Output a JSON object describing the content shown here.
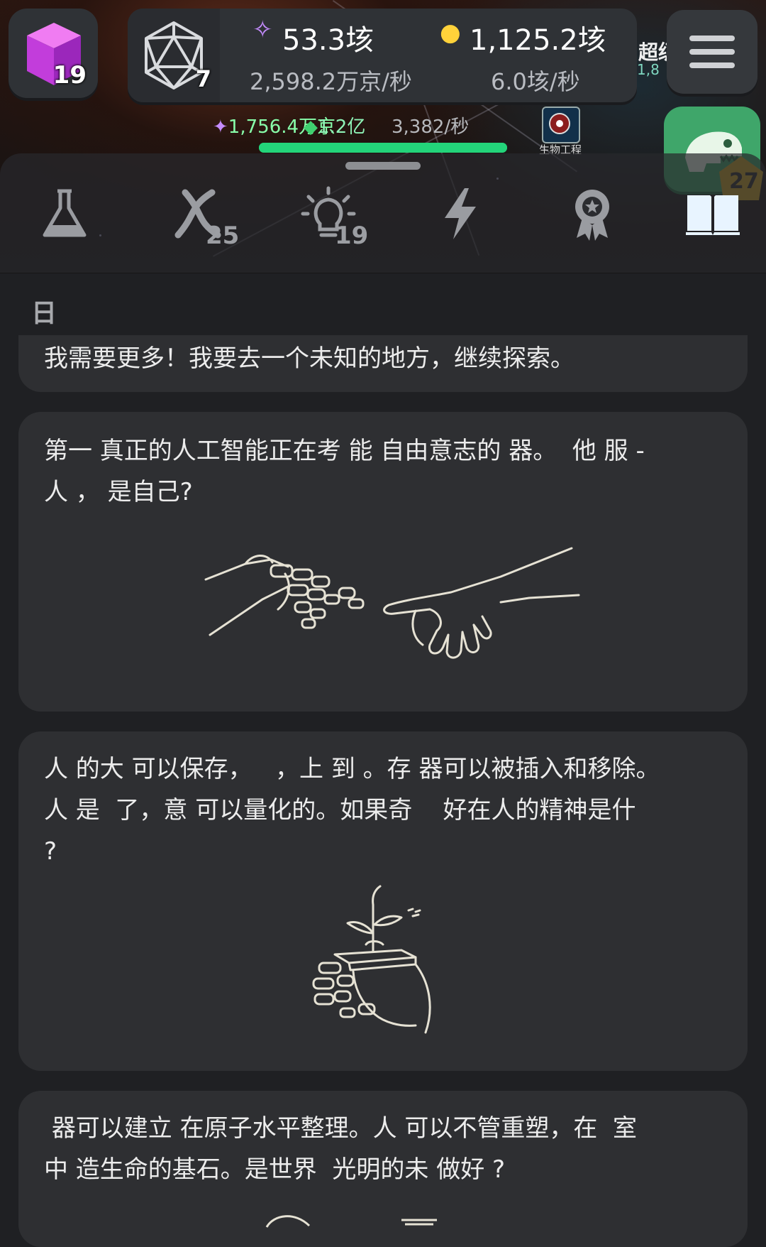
{
  "hud": {
    "cube_level": "19",
    "d20_level": "7",
    "resource1_value": "53.3垓",
    "resource1_rate": "2,598.2万京/秒",
    "resource2_value": "1,125.2垓",
    "resource2_rate": "6.0垓/秒",
    "side_label": "超级",
    "side_sub": "1,8",
    "dino_badge": "27"
  },
  "background": {
    "mid_left_value": "1,756.4万京",
    "gem_value": "1.2亿",
    "gem_rate": "3,382/秒",
    "bio_label": "生物工程",
    "progress": 1.0
  },
  "tabs": [
    {
      "name": "lab",
      "count": ""
    },
    {
      "name": "dna",
      "count": "25"
    },
    {
      "name": "idea",
      "count": "19"
    },
    {
      "name": "energy",
      "count": ""
    },
    {
      "name": "achievements",
      "count": ""
    },
    {
      "name": "journal",
      "count": ""
    }
  ],
  "section": {
    "title": "日"
  },
  "cards": [
    {
      "text": "我需要更多！我要去一个未知的地方，继续探索。"
    },
    {
      "text": "第一 真正的人工智能正在考 能 自由意志的 器。  他 服 -\n人 ， 是自己?"
    },
    {
      "text": "人 的大 可以保存，   ，上 到 。存 器可以被插入和移除。\n人 是  了，意 可以量化的。如果奇    好在人的精神是什\n?"
    },
    {
      "text": " 器可以建立 在原子水平整理。人 可以不管重塑，在  室\n中 造生命的基石。是世界  光明的未 做好 ?"
    }
  ],
  "colors": {
    "accent_green": "#23d47a",
    "card_bg": "#2e2f32",
    "page_bg": "#1f2023",
    "journal_tab_active": "#e8f4ff"
  }
}
